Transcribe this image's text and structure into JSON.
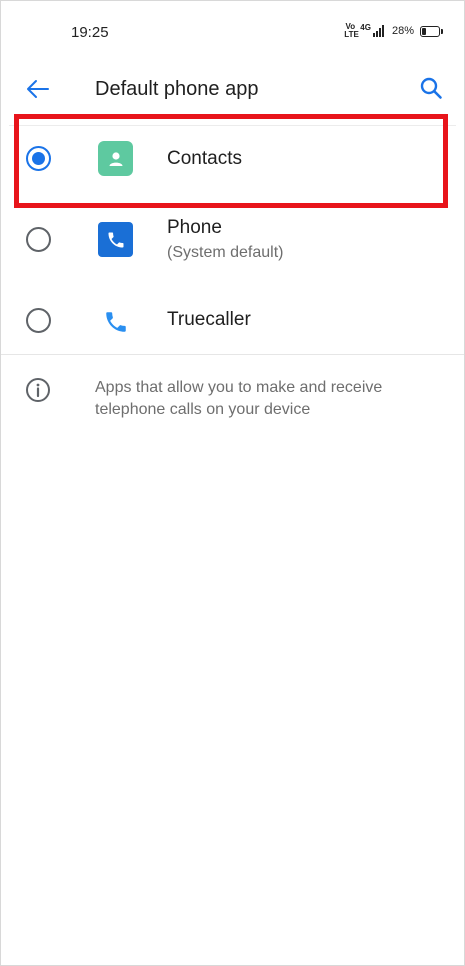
{
  "status_bar": {
    "time": "19:25",
    "volte": "Vo LTE",
    "network": "4G",
    "battery": "28%"
  },
  "app_bar": {
    "title": "Default phone app",
    "back_icon": "arrow-back-icon",
    "search_icon": "search-icon"
  },
  "options": [
    {
      "label": "Contacts",
      "subtitle": "",
      "selected": true,
      "icon": "contacts-icon"
    },
    {
      "label": "Phone",
      "subtitle": "(System default)",
      "selected": false,
      "icon": "phone-icon"
    },
    {
      "label": "Truecaller",
      "subtitle": "",
      "selected": false,
      "icon": "truecaller-icon"
    }
  ],
  "info": {
    "text": "Apps that allow you to make and receive telephone calls on your device",
    "icon": "info-icon"
  },
  "colors": {
    "accent": "#1a73e8",
    "highlight": "#e8141b",
    "contacts_icon_bg": "#5ec9a0",
    "phone_icon_bg": "#1a6fd6"
  }
}
